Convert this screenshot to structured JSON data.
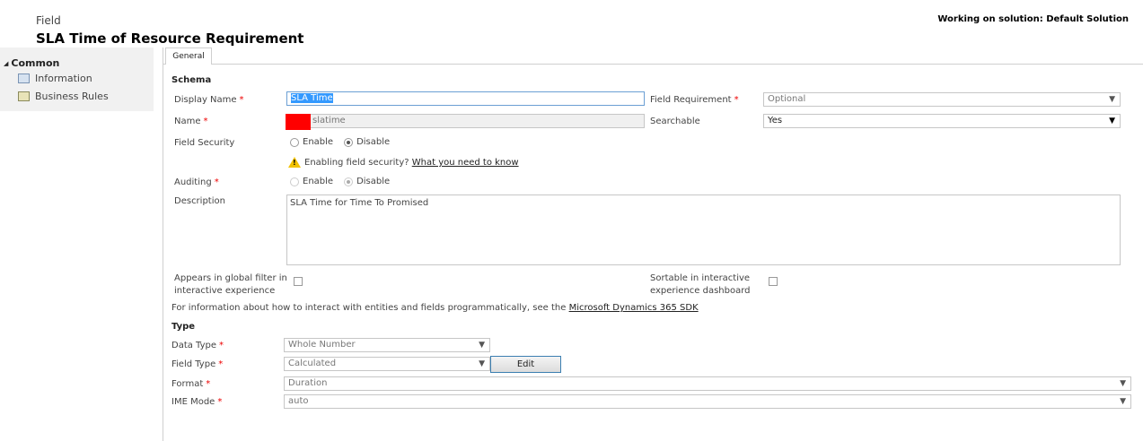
{
  "header": {
    "entity_label": "Field",
    "title": "SLA Time of Resource Requirement",
    "solution_text": "Working on solution: Default Solution"
  },
  "sidebar": {
    "group_label": "Common",
    "items": [
      {
        "label": "Information",
        "icon": "information-icon"
      },
      {
        "label": "Business Rules",
        "icon": "business-rules-icon"
      }
    ]
  },
  "tabs": [
    {
      "label": "General"
    }
  ],
  "schema": {
    "section_label": "Schema",
    "display_name_label": "Display Name",
    "display_name_value": "SLA Time",
    "name_label": "Name",
    "name_value": "slatime",
    "field_security_label": "Field Security",
    "enable_label": "Enable",
    "disable_label": "Disable",
    "warning_text": "Enabling field security?",
    "warning_link": "What you need to know",
    "auditing_label": "Auditing",
    "description_label": "Description",
    "description_value": "SLA Time for Time To Promised",
    "field_requirement_label": "Field Requirement",
    "field_requirement_value": "Optional",
    "searchable_label": "Searchable",
    "searchable_value": "Yes",
    "global_filter_label_1": "Appears in global filter in",
    "global_filter_label_2": "interactive experience",
    "sortable_label_1": "Sortable in interactive",
    "sortable_label_2": "experience dashboard",
    "sdk_text": "For information about how to interact with entities and fields programmatically, see the",
    "sdk_link": "Microsoft Dynamics 365 SDK"
  },
  "type": {
    "section_label": "Type",
    "data_type_label": "Data Type",
    "data_type_value": "Whole Number",
    "field_type_label": "Field Type",
    "field_type_value": "Calculated",
    "edit_label": "Edit",
    "format_label": "Format",
    "format_value": "Duration",
    "ime_mode_label": "IME Mode",
    "ime_mode_value": "auto"
  },
  "glyphs": {
    "required": "*",
    "arrow": "▼",
    "collapse": "◢",
    "warn": "!"
  },
  "colors": {
    "required": "#e00000",
    "focus_border": "#6b9fd4",
    "selection": "#3399ff",
    "redaction": "#ff0000"
  }
}
